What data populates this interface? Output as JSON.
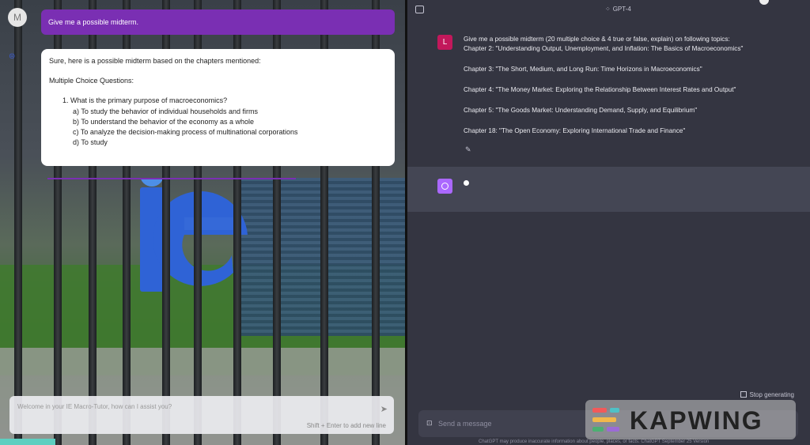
{
  "left_panel": {
    "avatar_letter": "M",
    "user_prompt": "Give me a possible midterm.",
    "answer": {
      "intro": "Sure, here is a possible midterm based on the chapters mentioned:",
      "section": "Multiple Choice Questions:",
      "question": "1. What is the primary purpose of macroeconomics?",
      "options": [
        "a) To study the behavior of individual households and firms",
        "b) To understand the behavior of the economy as a whole",
        "c) To analyze the decision-making process of multinational corporations",
        "d) To study"
      ]
    },
    "input": {
      "placeholder": "Welcome in your IE Macro-Tutor, how can I assist you?",
      "hint": "Shift + Enter to add new line"
    }
  },
  "right_panel": {
    "model": "GPT-4",
    "user_avatar": "L",
    "message_lines": [
      "Give me a possible midterm (20 multiple choice & 4 true or false, explain) on following topics:",
      "Chapter 2: \"Understanding Output, Unemployment, and Inflation: The Basics of Macroeconomics\"",
      "Chapter 3: \"The Short, Medium, and Long Run: Time Horizons in Macroeconomics\"",
      "Chapter 4: \"The Money Market: Exploring the Relationship Between Interest Rates and Output\"",
      "Chapter 5: \"The Goods Market: Understanding Demand, Supply, and Equilibrium\"",
      "Chapter 18: \"The Open Economy: Exploring International Trade and Finance\""
    ],
    "stop_generating": "Stop generating",
    "send_placeholder": "Send a message",
    "footer": "ChatGPT may produce inaccurate information about people, places, or facts. ChatGPT September 25 Version"
  },
  "watermark": {
    "text": "KAPWING"
  },
  "colors": {
    "user_bubble": "#7a2fb3",
    "chat_bg": "#343541",
    "assistant_bg": "#444654",
    "gpt_avatar": "#ab68ff",
    "user_avatar": "#c2185b"
  }
}
